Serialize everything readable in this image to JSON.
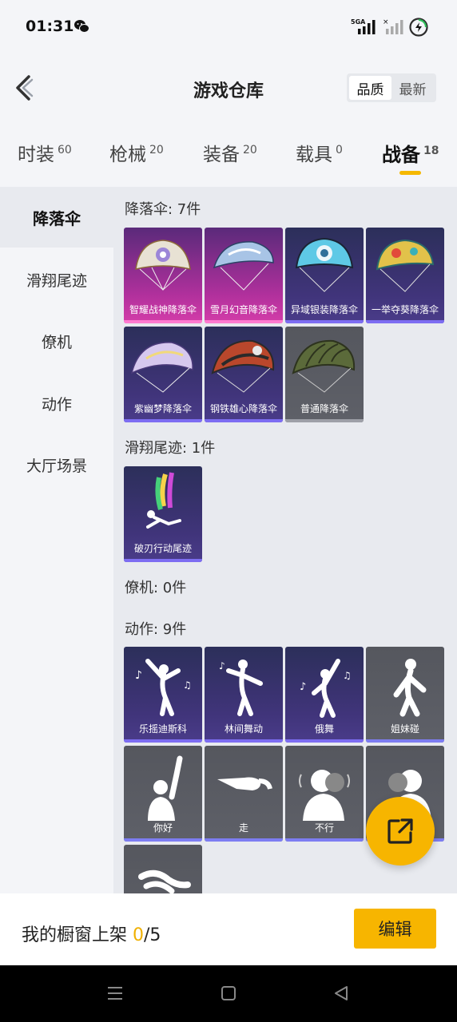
{
  "status_bar": {
    "time": "01:31",
    "network": "5GA"
  },
  "header": {
    "title": "游戏仓库",
    "sort_options": [
      "品质",
      "最新"
    ],
    "sort_selected": "品质"
  },
  "tabs": [
    {
      "label": "时装",
      "count": "60"
    },
    {
      "label": "枪械",
      "count": "20"
    },
    {
      "label": "装备",
      "count": "20"
    },
    {
      "label": "载具",
      "count": "0"
    },
    {
      "label": "战备",
      "count": "18"
    }
  ],
  "sidebar": [
    "降落伞",
    "滑翔尾迹",
    "僚机",
    "动作",
    "大厅场景"
  ],
  "sections": [
    {
      "title": "降落伞: 7件",
      "items": [
        {
          "name": "智耀战神降落伞",
          "rarity": "gold"
        },
        {
          "name": "雪月幻音降落伞",
          "rarity": "gold"
        },
        {
          "name": "异域银装降落伞",
          "rarity": "purple"
        },
        {
          "name": "一举夺葵降落伞",
          "rarity": "purple"
        },
        {
          "name": "紫幽梦降落伞",
          "rarity": "purple"
        },
        {
          "name": "钢铁雄心降落伞",
          "rarity": "purple"
        },
        {
          "name": "普通降落伞",
          "rarity": "grey"
        }
      ]
    },
    {
      "title": "滑翔尾迹: 1件",
      "items": [
        {
          "name": "破刃行动尾迹",
          "rarity": "purple"
        }
      ]
    },
    {
      "title": "僚机: 0件",
      "items": []
    },
    {
      "title": "动作: 9件",
      "items": [
        {
          "name": "乐摇迪斯科",
          "rarity": "purple"
        },
        {
          "name": "林间舞动",
          "rarity": "purple"
        },
        {
          "name": "俄舞",
          "rarity": "purple"
        },
        {
          "name": "姐妹碰",
          "rarity": "grey"
        },
        {
          "name": "你好",
          "rarity": "grey"
        },
        {
          "name": "走",
          "rarity": "grey"
        },
        {
          "name": "不行",
          "rarity": "grey"
        },
        {
          "name": "",
          "rarity": "grey"
        },
        {
          "name": "",
          "rarity": "grey"
        }
      ]
    }
  ],
  "bottom": {
    "shelf_label": "我的橱窗上架 ",
    "shelf_count": "0",
    "shelf_total": "/5",
    "edit_label": "编辑"
  },
  "colors": {
    "accent": "#f7b500",
    "gold_card": "#c0339f",
    "purple_card": "#40347a",
    "grey_card": "#5a5c63"
  }
}
